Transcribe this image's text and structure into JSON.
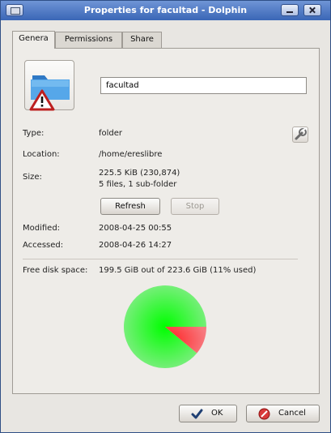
{
  "window": {
    "title": "Properties for facultad - Dolphin"
  },
  "tabs": [
    {
      "label": "Genera"
    },
    {
      "label": "Permissions"
    },
    {
      "label": "Share"
    }
  ],
  "general": {
    "name_value": "facultad",
    "rows": {
      "type": {
        "label": "Type:",
        "value": "folder"
      },
      "location": {
        "label": "Location:",
        "value": "/home/ereslibre"
      },
      "size": {
        "label": "Size:",
        "value_line1": "225.5 KiB (230,874)",
        "value_line2": "5 files, 1 sub-folder"
      },
      "modified": {
        "label": "Modified:",
        "value": "2008-04-25 00:55"
      },
      "accessed": {
        "label": "Accessed:",
        "value": "2008-04-26 14:27"
      },
      "free_disk": {
        "label": "Free disk space:",
        "value": "199.5 GiB out of 223.6 GiB (11% used)"
      }
    },
    "refresh_label": "Refresh",
    "stop_label": "Stop",
    "disk_usage": {
      "used_fraction": 0.11,
      "used_color": "#f35b67",
      "free_color": "#24e62f"
    }
  },
  "dialog": {
    "ok_label": "OK",
    "cancel_label": "Cancel"
  },
  "icons": {
    "folder": "folder-warning-icon",
    "wrench": "wrench-icon",
    "ok": "checkmark-icon",
    "cancel": "cancel-icon"
  }
}
